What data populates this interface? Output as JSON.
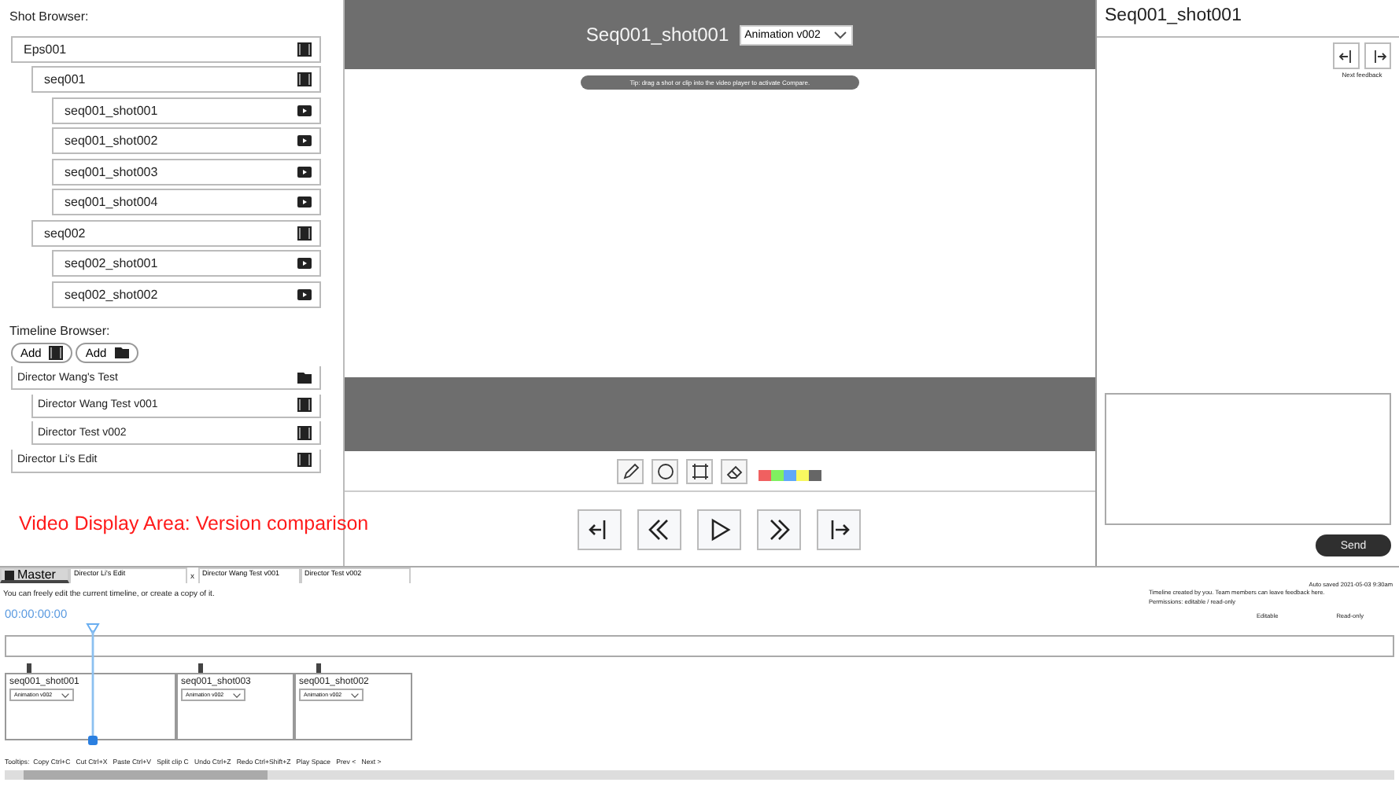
{
  "shot_browser": {
    "title": "Shot Browser:",
    "tree": [
      {
        "label": "Eps001",
        "kind": "group",
        "children": [
          {
            "label": "seq001",
            "kind": "group",
            "children": [
              {
                "label": "seq001_shot001",
                "kind": "shot"
              },
              {
                "label": "seq001_shot002",
                "kind": "shot"
              },
              {
                "label": "seq001_shot003",
                "kind": "shot"
              },
              {
                "label": "seq001_shot004",
                "kind": "shot"
              }
            ]
          },
          {
            "label": "seq002",
            "kind": "group",
            "children": [
              {
                "label": "seq002_shot001",
                "kind": "shot"
              },
              {
                "label": "seq002_shot002",
                "kind": "shot"
              }
            ]
          }
        ]
      }
    ]
  },
  "timeline_browser": {
    "title": "Timeline Browser:",
    "add_buttons": [
      {
        "label": "Add",
        "kind": "timeline"
      },
      {
        "label": "Add",
        "kind": "folder"
      }
    ],
    "tree": [
      {
        "label": "Director Wang's Test",
        "kind": "folder",
        "children": [
          {
            "label": "Director Wang Test v001",
            "kind": "timeline"
          },
          {
            "label": "Director Test v002",
            "kind": "timeline"
          }
        ]
      },
      {
        "label": "Director Li's Edit",
        "kind": "timeline"
      }
    ]
  },
  "annotation": "Video Display Area: Version comparison",
  "viewer": {
    "shot_title": "Seq001_shot001",
    "version": "Animation v002",
    "tip": "Tip: drag a shot or clip into the video player to activate Compare.",
    "tools": [
      {
        "kind": "pencil"
      },
      {
        "kind": "circle"
      },
      {
        "kind": "rectangle"
      },
      {
        "kind": "eraser"
      }
    ],
    "swatches": [
      {
        "color": "#f06060"
      },
      {
        "color": "#80f060"
      },
      {
        "color": "#60a8f8"
      },
      {
        "color": "#f8f860"
      },
      {
        "color": "#666666"
      }
    ],
    "transport": [
      {
        "kind": "first"
      },
      {
        "kind": "rewind"
      },
      {
        "kind": "play"
      },
      {
        "kind": "forward"
      },
      {
        "kind": "last"
      }
    ]
  },
  "feedback": {
    "title": "Seq001_shot001",
    "nav": [
      {
        "kind": "prev"
      },
      {
        "kind": "next"
      }
    ],
    "nav_label": "Next feedback",
    "send": "Send"
  },
  "timeline": {
    "tabs": [
      {
        "label": "Master",
        "kind": "master",
        "selected": true
      },
      {
        "label": "Director Li's Edit",
        "kind": "tab",
        "close": "x",
        "selected": false
      },
      {
        "label": "Director Wang Test v001",
        "kind": "tab",
        "selected": false
      },
      {
        "label": "Director Test v002",
        "kind": "tab",
        "selected": false
      }
    ],
    "message": "You can freely edit the current timeline, or create a copy of it.",
    "timecode": "00:00:00:00",
    "info": {
      "autosave": "Auto saved 2021-05-03 9:30am",
      "created": "Timeline created by you. Team members can leave feedback here.",
      "permissions": "Permissions: editable / read-only",
      "modes": [
        "Editable",
        "Read-only"
      ]
    },
    "clips": [
      {
        "name": "seq001_shot001",
        "version": "Animation v002",
        "kind": "long"
      },
      {
        "name": "seq001_shot003",
        "version": "Animation v002",
        "kind": "short"
      },
      {
        "name": "seq001_shot002",
        "version": "Animation v002",
        "kind": "short"
      }
    ],
    "tooltips": "Tooltips:  Copy Ctrl+C   Cut Ctrl+X   Paste Ctrl+V   Split clip C   Undo Ctrl+Z   Redo Ctrl+Shift+Z   Play Space   Prev <   Next >"
  }
}
